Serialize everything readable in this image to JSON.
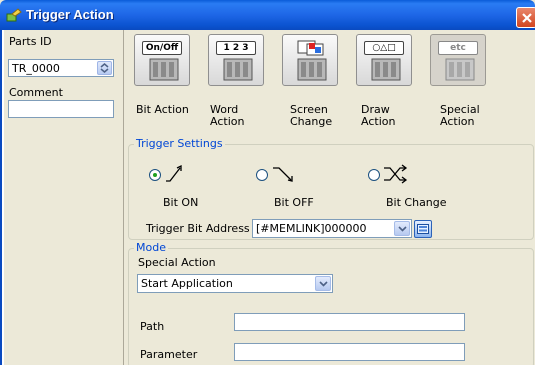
{
  "window": {
    "title": "Trigger Action",
    "icon": "app-icon",
    "close_icon": "close-icon"
  },
  "left": {
    "parts_id_label": "Parts ID",
    "parts_id_value": "TR_0000",
    "comment_label": "Comment",
    "comment_value": ""
  },
  "actions": [
    {
      "tag": "On/Off",
      "caption_line1": "Bit Action",
      "caption_line2": ""
    },
    {
      "tag": "1 2 3",
      "caption_line1": "Word",
      "caption_line2": "Action"
    },
    {
      "tag": "",
      "caption_line1": "Screen",
      "caption_line2": "Change"
    },
    {
      "tag": "○△□",
      "caption_line1": "Draw",
      "caption_line2": "Action"
    },
    {
      "tag": "etc",
      "caption_line1": "Special",
      "caption_line2": "Action"
    }
  ],
  "selected_action_index": 4,
  "trigger_settings": {
    "group_title": "Trigger Settings",
    "options": [
      {
        "label": "Bit ON",
        "icon": "bit-on-icon",
        "checked": true
      },
      {
        "label": "Bit OFF",
        "icon": "bit-off-icon",
        "checked": false
      },
      {
        "label": "Bit Change",
        "icon": "bit-change-icon",
        "checked": false
      }
    ],
    "address_label": "Trigger Bit Address",
    "address_value": "[#MEMLINK]000000"
  },
  "mode": {
    "group_title": "Mode",
    "special_action_label": "Special Action",
    "special_action_value": "Start Application",
    "path_label": "Path",
    "path_value": "",
    "parameter_label": "Parameter",
    "parameter_value": ""
  }
}
